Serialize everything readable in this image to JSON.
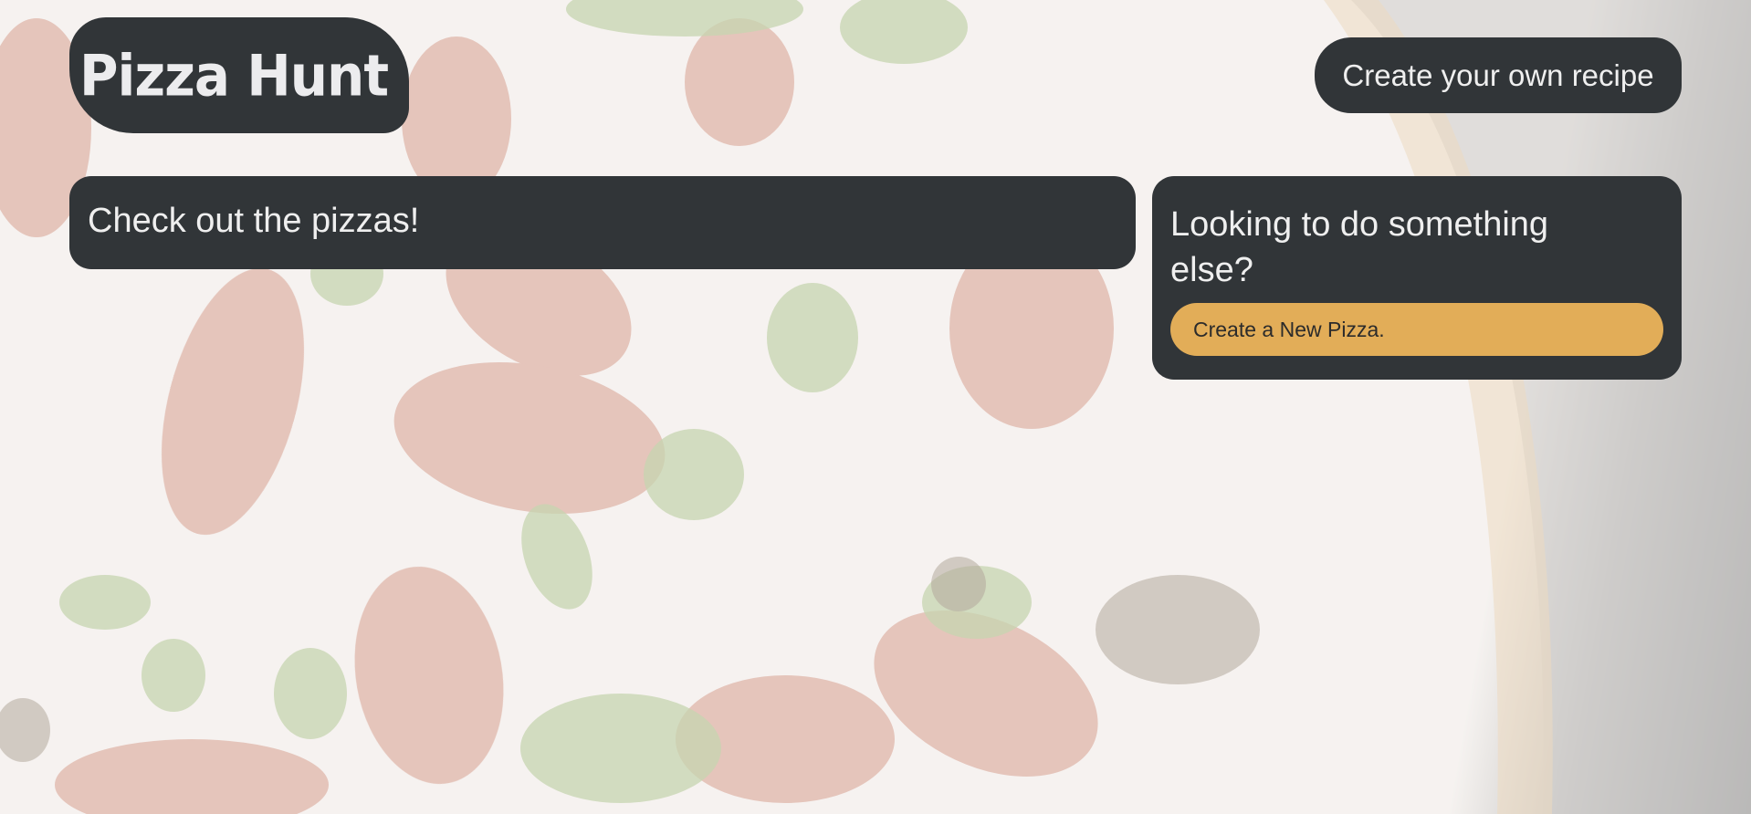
{
  "header": {
    "logo_text": "Pizza Hunt",
    "recipe_button_label": "Create your own recipe"
  },
  "main": {
    "pizzas_heading": "Check out the pizzas!"
  },
  "side_panel": {
    "heading": "Looking to do something else?",
    "create_button_label": "Create a New Pizza."
  },
  "colors": {
    "panel": "#313538",
    "accent": "#e2ad58",
    "panel_text": "#efefef"
  },
  "background": {
    "description_icon": "pizza-photo"
  }
}
